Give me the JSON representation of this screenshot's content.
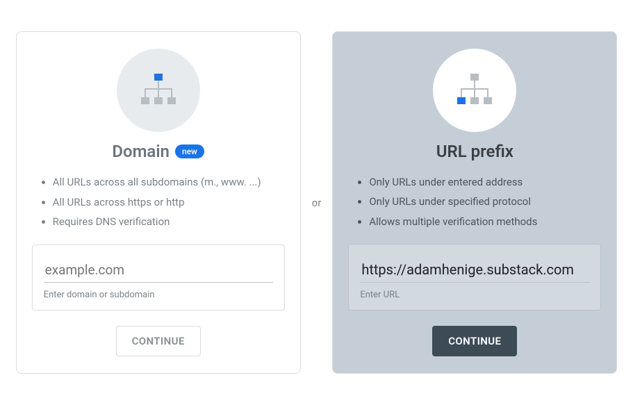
{
  "separator": "or",
  "domain": {
    "title": "Domain",
    "badge": "new",
    "bullets": [
      "All URLs across all subdomains (m., www. ...)",
      "All URLs across https or http",
      "Requires DNS verification"
    ],
    "input_value": "",
    "input_placeholder": "example.com",
    "helper": "Enter domain or subdomain",
    "button": "CONTINUE"
  },
  "urlprefix": {
    "title": "URL prefix",
    "bullets": [
      "Only URLs under entered address",
      "Only URLs under specified protocol",
      "Allows multiple verification methods"
    ],
    "input_value": "https://adamhenige.substack.com",
    "input_placeholder": "",
    "helper": "Enter URL",
    "button": "CONTINUE"
  }
}
